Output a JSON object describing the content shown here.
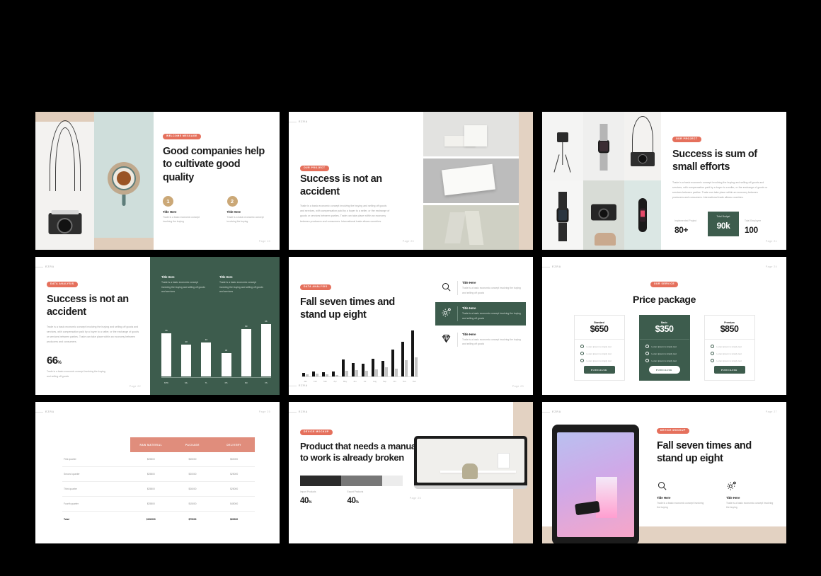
{
  "brand": {
    "logo": "EZRA",
    "accent_coral": "#e5705c",
    "accent_green": "#3d5c4d",
    "accent_tan": "#cba877",
    "accent_beige": "#e3d2c2"
  },
  "lorem": {
    "paragraph": "Trade is a basic economic concept involving the buying and selling off goods and services, with compensation paid by a buyer to a seller, or the exchange of goods or services between parties. Trade can take place within an economy between producers and consumers. International trade allows countries.",
    "paragraph_short": "Trade is a basic economic concept involving the buying and selling off goods and services, with compensation paid by a buyer to a seller, or the exchange of goods or services between parties. Trade can take place within an economy between producers and consumers.",
    "snippet": "Trade is a basic economic concept involving the buying",
    "snippet2": "Trade is a basic economic concept involving the buying and selling off goods and services",
    "snippet3": "Trade is a basic economic concept involving the buying and selling off goods"
  },
  "slides": [
    {
      "id": "welcome",
      "badge": "WELCOME MESSAGE",
      "title": "Good companies help to cultivate good quality",
      "page": "Page 10",
      "items": [
        {
          "num": "1",
          "title": "Title Here"
        },
        {
          "num": "2",
          "title": "Title Here"
        }
      ]
    },
    {
      "id": "our-project",
      "badge": "OUR PROJECT",
      "title": "Success is not an accident",
      "page": "Page 20"
    },
    {
      "id": "success-sum",
      "badge": "OUR PROJECT",
      "title": "Success is sum of small efforts",
      "page": "Page 21",
      "stats": [
        {
          "label": "Implemented Project",
          "value": "80+"
        },
        {
          "label": "Total Budget",
          "value": "90k"
        },
        {
          "label": "Total Employee",
          "value": "100"
        }
      ]
    },
    {
      "id": "data-analysis-1",
      "badge": "DATA ANALYSIS",
      "title": "Success is not an accident",
      "page": "Page 22",
      "big_number": "66",
      "big_number_suffix": "%",
      "panels": [
        {
          "title": "Title Here"
        },
        {
          "title": "Title Here"
        }
      ]
    },
    {
      "id": "data-analysis-2",
      "badge": "DATA ANALYSIS",
      "title": "Fall seven times and stand up eight",
      "page": "Page 23",
      "features": [
        {
          "icon": "search-icon",
          "title": "Title Here",
          "active": false
        },
        {
          "icon": "gear-icon",
          "title": "Title Here",
          "active": true
        },
        {
          "icon": "diamond-icon",
          "title": "Title Here",
          "active": false
        }
      ]
    },
    {
      "id": "price-package",
      "badge": "OUR SERVICE",
      "title": "Price package",
      "page": "Page 24",
      "plans": [
        {
          "name": "Standard",
          "price": "$650",
          "cta": "PURCHASE",
          "highlight": false,
          "features": [
            "Lorem ipsum is simply text",
            "Lorem ipsum is simply text",
            "Lorem ipsum is simply text"
          ]
        },
        {
          "name": "Basic",
          "price": "$350",
          "cta": "PURCHASE",
          "highlight": true,
          "features": [
            "Lorem ipsum is simply text",
            "Lorem ipsum is simply text",
            "Lorem ipsum is simply text"
          ]
        },
        {
          "name": "Premium",
          "price": "$850",
          "cta": "PURCHASE",
          "highlight": false,
          "features": [
            "Lorem ipsum is simply text",
            "Lorem ipsum is simply text",
            "Lorem ipsum is simply text"
          ]
        }
      ]
    },
    {
      "id": "table-slide",
      "page": "Page 25"
    },
    {
      "id": "device-mockup-laptop",
      "badge": "DEVICE MOCKUP",
      "title": "Product that  needs a manual to work is already broken",
      "page": "Page 26",
      "metrics": [
        {
          "label": "Import Products",
          "value": "40",
          "suffix": "%"
        },
        {
          "label": "Export Products",
          "value": "40",
          "suffix": "%"
        }
      ]
    },
    {
      "id": "device-mockup-tablet",
      "badge": "DEVICE MOCKUP",
      "title": "Fall seven times and stand up eight",
      "page": "Page 27",
      "features": [
        {
          "icon": "search-icon",
          "title": "Title Here"
        },
        {
          "icon": "gear-icon",
          "title": "Title Here"
        }
      ]
    }
  ],
  "chart_data": [
    {
      "type": "bar",
      "slide": "data-analysis-1",
      "title": "",
      "categories": [
        "MTK",
        "ML",
        "TL",
        "PS",
        "SD",
        "VS"
      ],
      "values": [
        55,
        40,
        43,
        30,
        60,
        66
      ],
      "ylim": [
        0,
        70
      ],
      "grid": false,
      "legend": "none",
      "bar_color": "#ffffff",
      "background": "#3d5c4d"
    },
    {
      "type": "bar",
      "slide": "data-analysis-2",
      "title": "",
      "categories": [
        "Jan",
        "Feb",
        "Mar",
        "Apr",
        "May",
        "Jun",
        "Jul",
        "Aug",
        "Sep",
        "Oct",
        "Nov",
        "Dec"
      ],
      "series": [
        {
          "name": "Series 1",
          "values": [
            5,
            7,
            6,
            8,
            26,
            20,
            19,
            27,
            24,
            41,
            52,
            70
          ],
          "color": "#151515"
        },
        {
          "name": "Series 2",
          "values": [
            3,
            4,
            3,
            2,
            9,
            10,
            9,
            11,
            14,
            12,
            25,
            29
          ],
          "color": "#c4c4c4"
        }
      ],
      "ylim": [
        0,
        75
      ],
      "grid": false,
      "legend": "none"
    },
    {
      "type": "bar",
      "slide": "device-mockup-laptop",
      "orientation": "horizontal-stacked",
      "categories": [
        "Import Products",
        "Export Products",
        "Remainder"
      ],
      "values": [
        40,
        40,
        20
      ],
      "colors": [
        "#2b2b2b",
        "#777777",
        "#ececec"
      ],
      "ylim": [
        0,
        100
      ]
    }
  ],
  "table": {
    "row_header_label": "",
    "columns": [
      "RAW MATERIAL",
      "PACKAGE",
      "DELIVERY"
    ],
    "rows": [
      {
        "label": "First quarter",
        "cells": [
          "$25800",
          "$45000",
          "$60000"
        ]
      },
      {
        "label": "Second quarter",
        "cells": [
          "$25800",
          "$20000",
          "$25000"
        ]
      },
      {
        "label": "Third quarter",
        "cells": [
          "$25800",
          "$26000",
          "$25000"
        ]
      },
      {
        "label": "Fourth quarter",
        "cells": [
          "$25800",
          "$15000",
          "$45000"
        ]
      }
    ],
    "total": {
      "label": "Total",
      "cells": [
        "$100000",
        "$75000",
        "$60000"
      ]
    }
  }
}
